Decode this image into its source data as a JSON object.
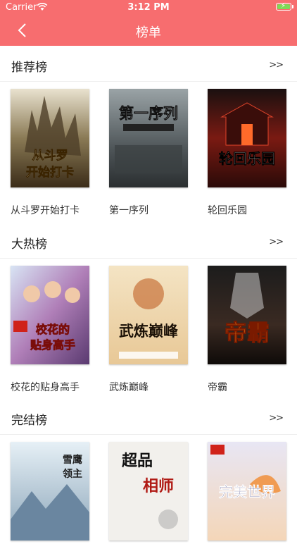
{
  "status_bar": {
    "carrier": "Carrier",
    "time": "3:12 PM"
  },
  "nav": {
    "title": "榜单"
  },
  "sections": [
    {
      "title": "推荐榜",
      "more": ">>",
      "books": [
        {
          "title": "从斗罗开始打卡",
          "cover_text": "从斗罗开始打卡"
        },
        {
          "title": "第一序列",
          "cover_text": "第一序列"
        },
        {
          "title": "轮回乐园",
          "cover_text": "轮回乐园"
        }
      ]
    },
    {
      "title": "大热榜",
      "more": ">>",
      "books": [
        {
          "title": "校花的贴身高手",
          "cover_text": "校花的贴身高手"
        },
        {
          "title": "武炼巅峰",
          "cover_text": "武炼巅峰"
        },
        {
          "title": "帝霸",
          "cover_text": "帝霸"
        }
      ]
    },
    {
      "title": "完结榜",
      "more": ">>",
      "books": [
        {
          "title": "",
          "cover_text": "雪鹰领主"
        },
        {
          "title": "",
          "cover_text": "超品相师"
        },
        {
          "title": "",
          "cover_text": "完美世界"
        }
      ]
    }
  ]
}
